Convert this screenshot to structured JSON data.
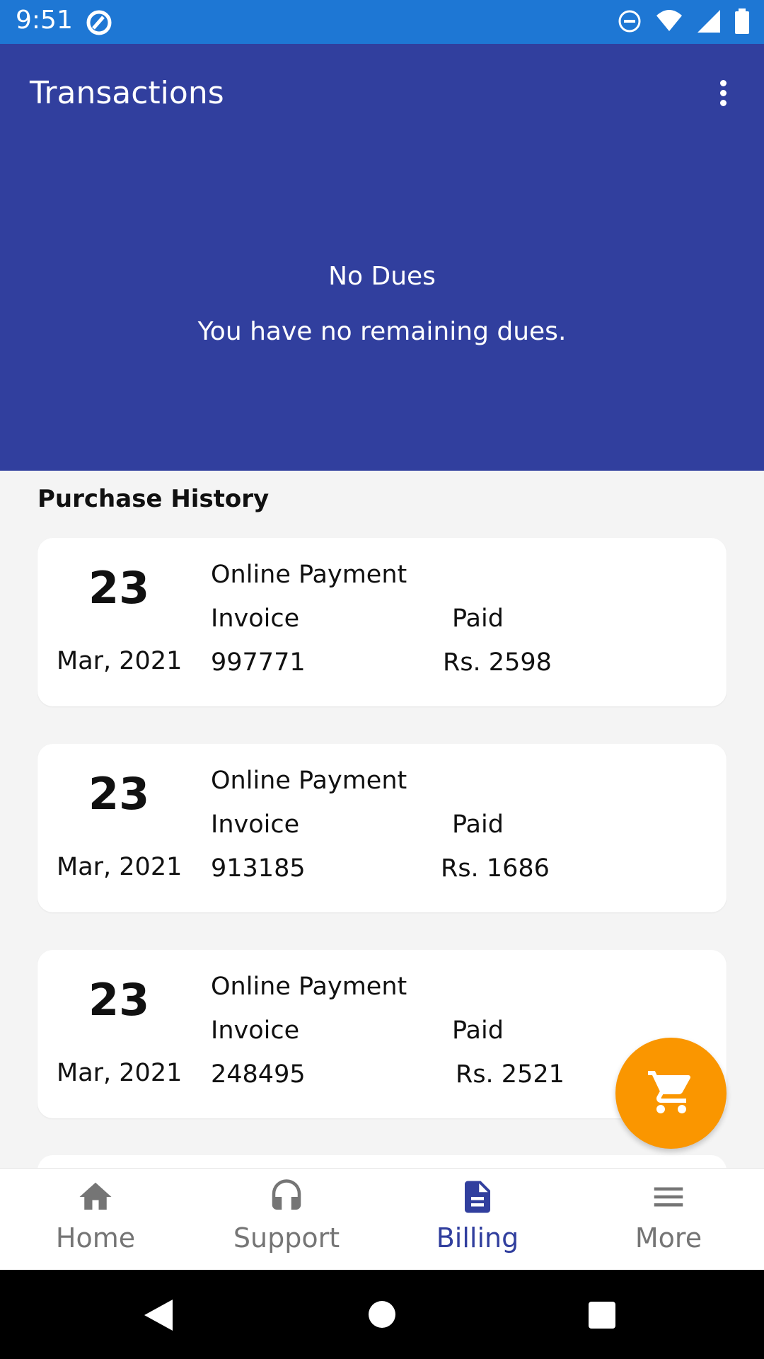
{
  "status_bar": {
    "time": "9:51"
  },
  "header": {
    "title": "Transactions"
  },
  "dues": {
    "title": "No Dues",
    "subtitle": "You have no remaining dues."
  },
  "purchase_history": {
    "title": "Purchase History",
    "items": [
      {
        "day": "23",
        "month_year": "Mar, 2021",
        "payment_type": "Online Payment",
        "invoice_label": "Invoice",
        "invoice_number": "997771",
        "paid_label": "Paid",
        "paid_amount": "Rs. 2598"
      },
      {
        "day": "23",
        "month_year": "Mar, 2021",
        "payment_type": "Online Payment",
        "invoice_label": "Invoice",
        "invoice_number": "913185",
        "paid_label": "Paid",
        "paid_amount": "Rs. 1686"
      },
      {
        "day": "23",
        "month_year": "Mar, 2021",
        "payment_type": "Online Payment",
        "invoice_label": "Invoice",
        "invoice_number": "248495",
        "paid_label": "Paid",
        "paid_amount": "Rs. 2521"
      }
    ]
  },
  "fab": {
    "icon": "cart-icon",
    "color": "#fa9600"
  },
  "bottom_nav": {
    "active": "Billing",
    "items": [
      {
        "label": "Home",
        "icon": "home-icon"
      },
      {
        "label": "Support",
        "icon": "headset-icon"
      },
      {
        "label": "Billing",
        "icon": "document-icon"
      },
      {
        "label": "More",
        "icon": "menu-icon"
      }
    ]
  },
  "colors": {
    "primary": "#313f9e",
    "status_bar": "#1e77d4",
    "accent": "#fa9600",
    "background": "#f4f4f4"
  }
}
